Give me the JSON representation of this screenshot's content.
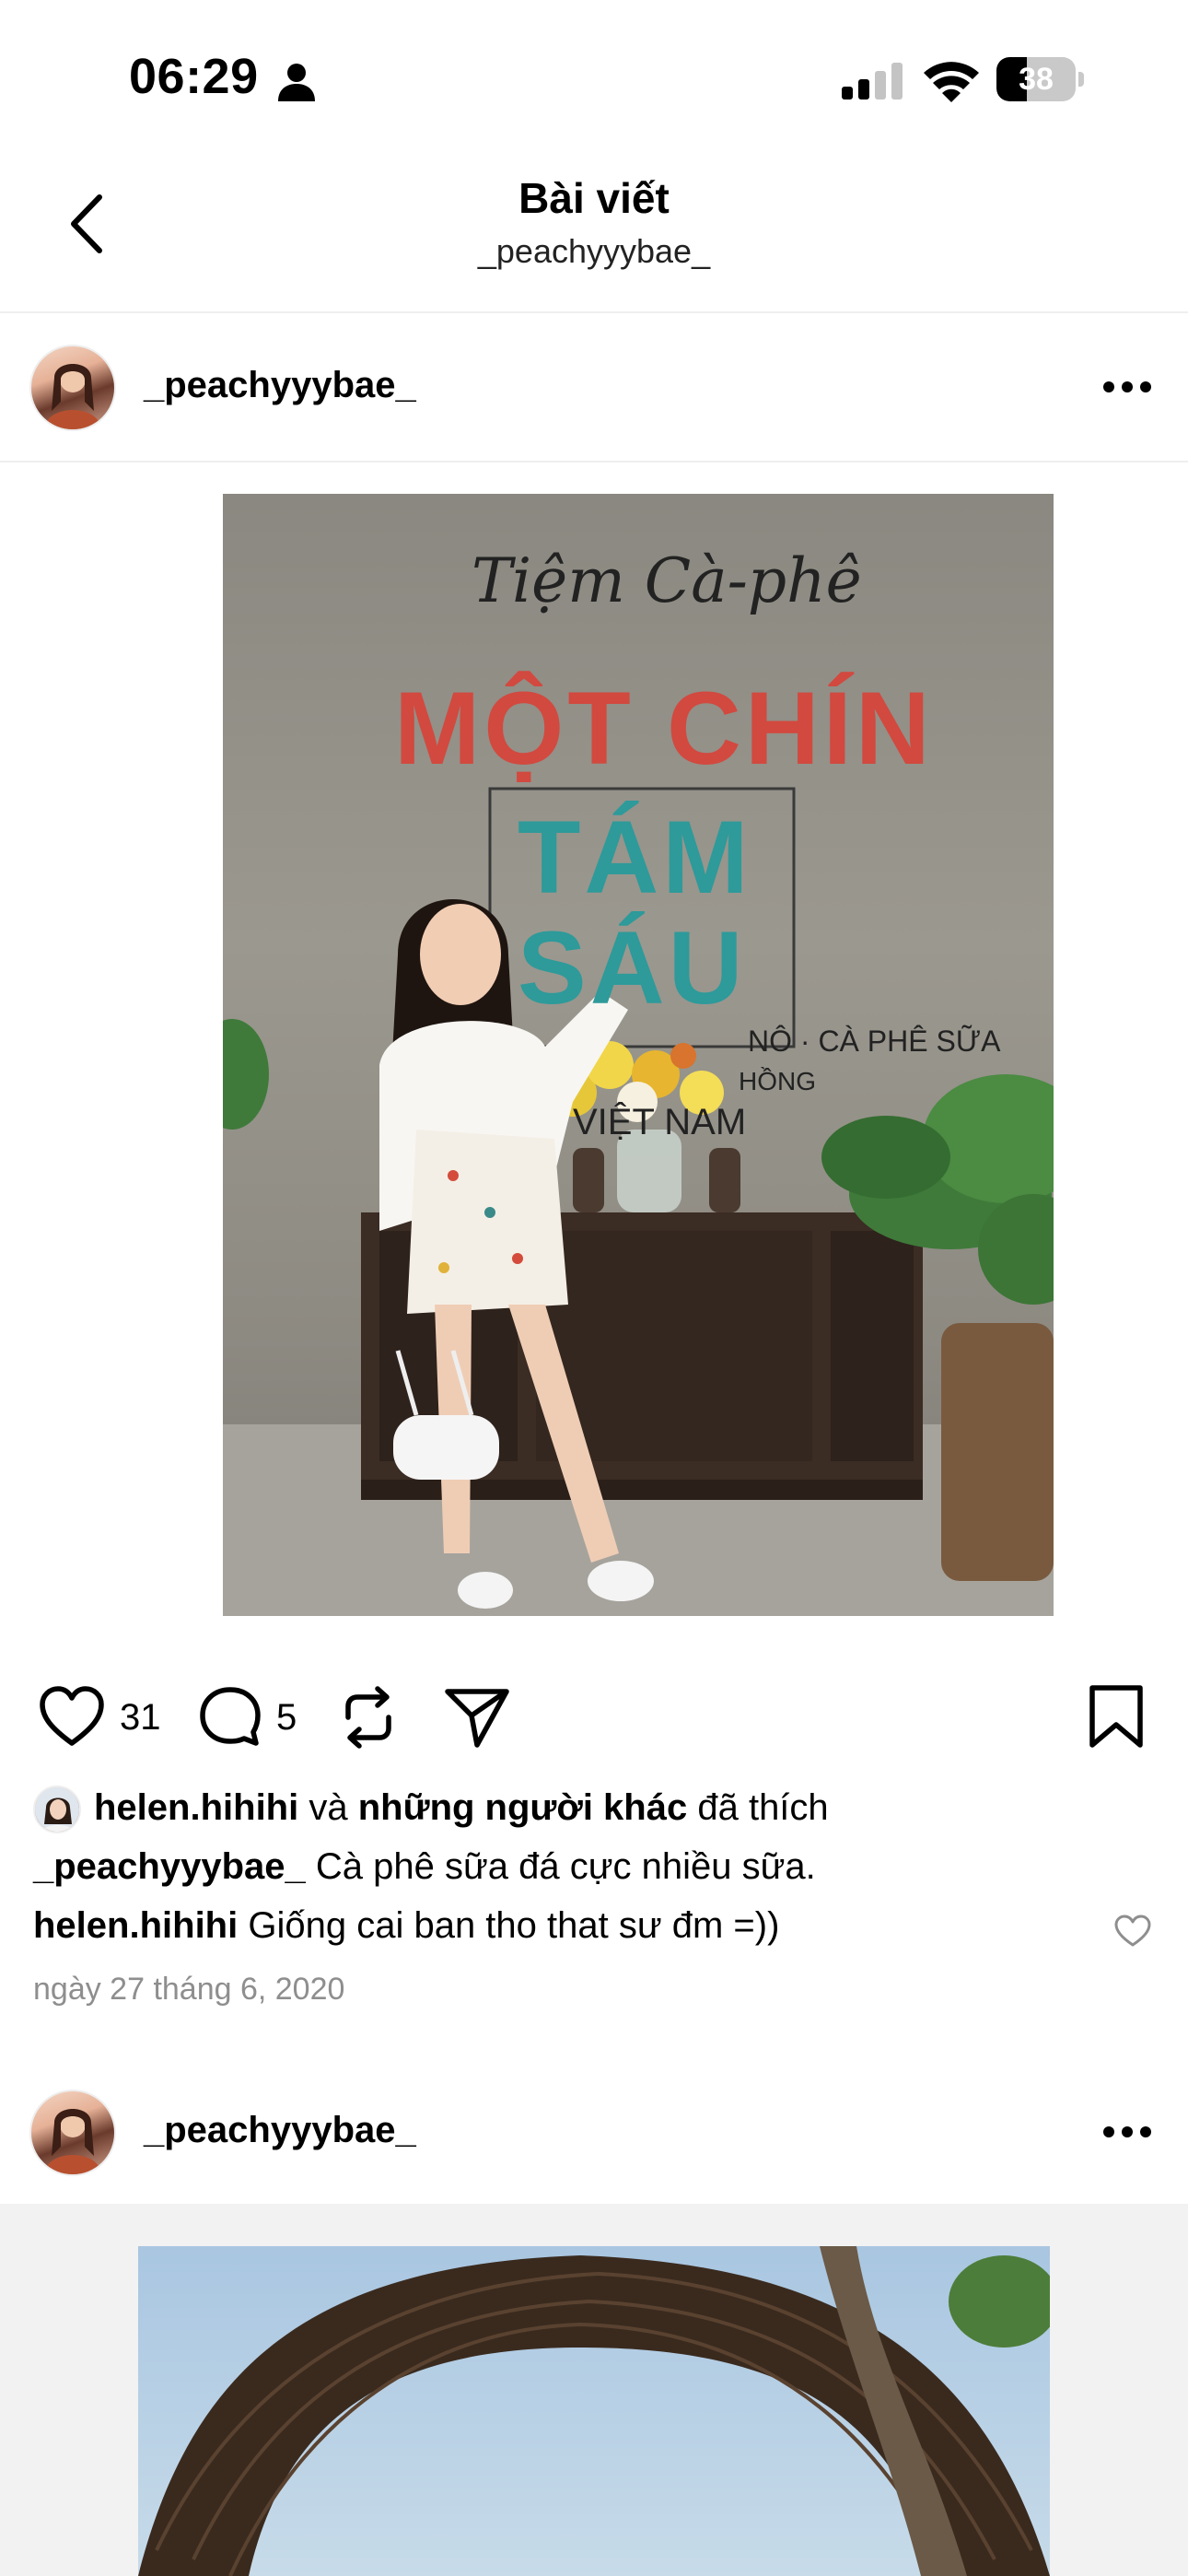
{
  "status_bar": {
    "time": "06:29",
    "battery": "38",
    "battery_level": 0.38
  },
  "header": {
    "title": "Bài viết",
    "subtitle": "_peachyyybae_"
  },
  "post1": {
    "username": "_peachyyybae_",
    "photo_sign": {
      "line1": "Tiệm Cà-phê",
      "line2": "MỘT CHÍN",
      "line3": "TÁM",
      "line4": "SÁU",
      "line5": "NÔ · CÀ PHÊ SỮA",
      "line6": "HỒNG",
      "line7": "VIỆT NAM"
    },
    "likes_count": "31",
    "comments_count": "5",
    "liked_by_user": "helen.hihihi",
    "liked_by_and": "và",
    "liked_by_others": "những người khác",
    "liked_by_suffix": "đã thích",
    "caption_user": "_peachyyybae_",
    "caption_text": "Cà phê sữa đá cực nhiều sữa.",
    "comment_user": "helen.hihihi",
    "comment_text": "Giống cai ban tho that sư đm =))",
    "date": "ngày 27 tháng 6, 2020"
  },
  "post2": {
    "username": "_peachyyybae_"
  },
  "colors": {
    "sign_red": "#d2493f",
    "sign_teal": "#2e9a9a",
    "muted_text": "#8e8e8e"
  }
}
